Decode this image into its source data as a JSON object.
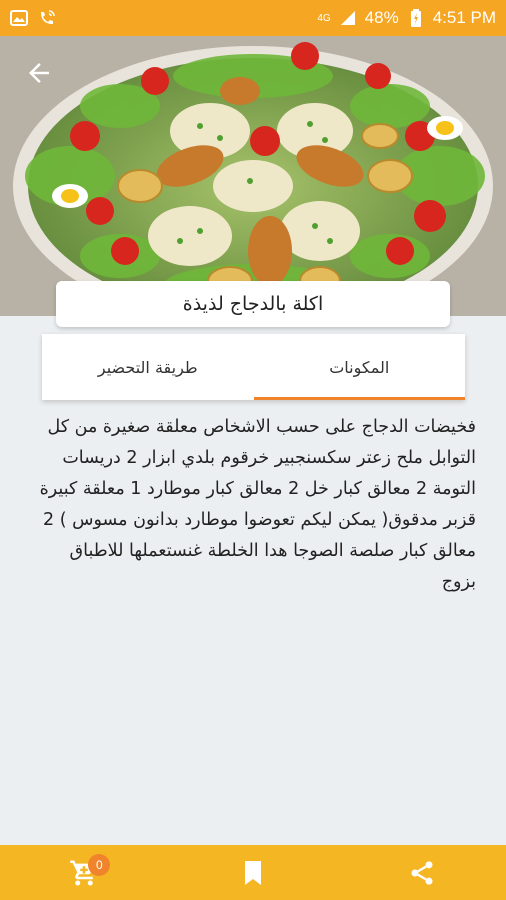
{
  "status_bar": {
    "battery_percent": "48%",
    "time": "4:51 PM",
    "network": "4G",
    "icons": [
      "gallery-icon",
      "wifi-call-icon",
      "signal-icon",
      "battery-icon"
    ]
  },
  "recipe": {
    "title": "اكلة بالدجاج لذيذة",
    "image": "chicken-rice-platter"
  },
  "tabs": [
    {
      "label": "طريقة التحضير",
      "active": false
    },
    {
      "label": "المكونات",
      "active": true
    }
  ],
  "ingredients_text": "فخيضات الدجاج على حسب الاشخاص معلقة صغيرة من كل التوابل ملح زعتر سكسنجبير خرقوم بلدي ابزار 2 دريسات التومة 2 معالق كبار خل 2 معالق كبار موطارد 1 معلقة كبيرة قزبر مدقوق( يمكن ليكم تعوضوا موطارد بدانون مسوس ) 2 معالق كبار صلصة الصوجا هدا الخلطة غنستعملها للاطباق بزوج",
  "bottom_bar": {
    "cart_count": "0",
    "icons": [
      "cart-icon",
      "bookmark-icon",
      "share-icon"
    ]
  },
  "colors": {
    "accent": "#f5a623",
    "tab_indicator": "#f0842c",
    "background": "#eceff1"
  }
}
